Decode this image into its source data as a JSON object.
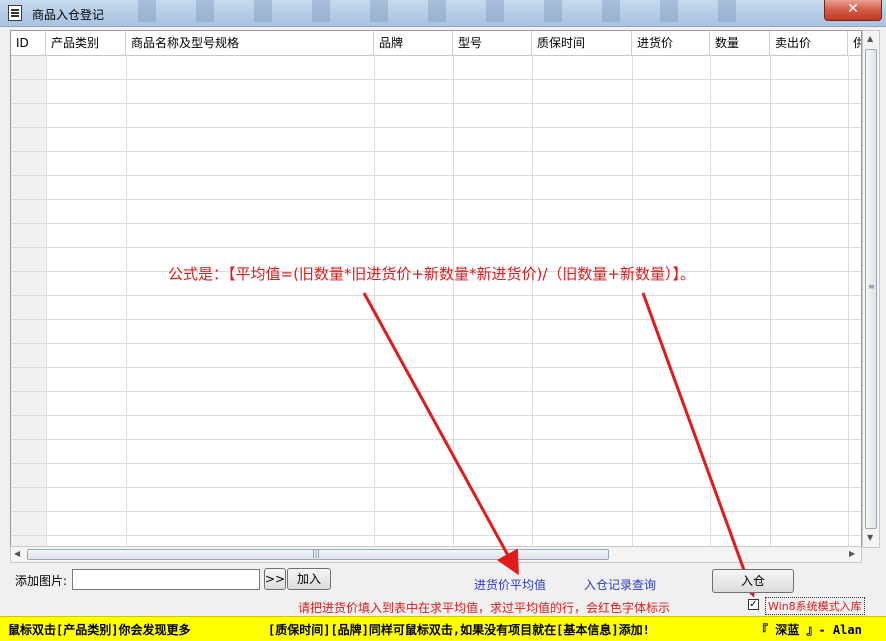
{
  "window": {
    "title": "商品入仓登记",
    "close_label": "✕"
  },
  "table": {
    "columns": [
      "ID",
      "产品类别",
      "商品名称及型号规格",
      "品牌",
      "型号",
      "质保时间",
      "进货价",
      "数量",
      "卖出价",
      "供"
    ],
    "rows": []
  },
  "annotation": {
    "formula": "公式是：【平均值=(旧数量*旧进货价+新数量*新进货价)/（旧数量+新数量）】。"
  },
  "controls": {
    "add_image_label": "添加图片:",
    "image_path_value": "",
    "browse_label": ">>",
    "add_label": "加入",
    "avg_price_link": "进货价平均值",
    "history_link": "入仓记录查询",
    "submit_label": "入仓",
    "hint": "请把进货价填入到表中在求平均值，求过平均值的行，会红色字体标示",
    "win8_mode_label": "Win8系统模式入库",
    "win8_mode_checked": true
  },
  "statusbar": {
    "left": "鼠标双击[产品类别]你会发现更多",
    "middle": "[质保时间][品牌]同样可鼠标双击,如果没有项目就在[基本信息]添加!",
    "right": "『 深蓝 』- Alan"
  }
}
